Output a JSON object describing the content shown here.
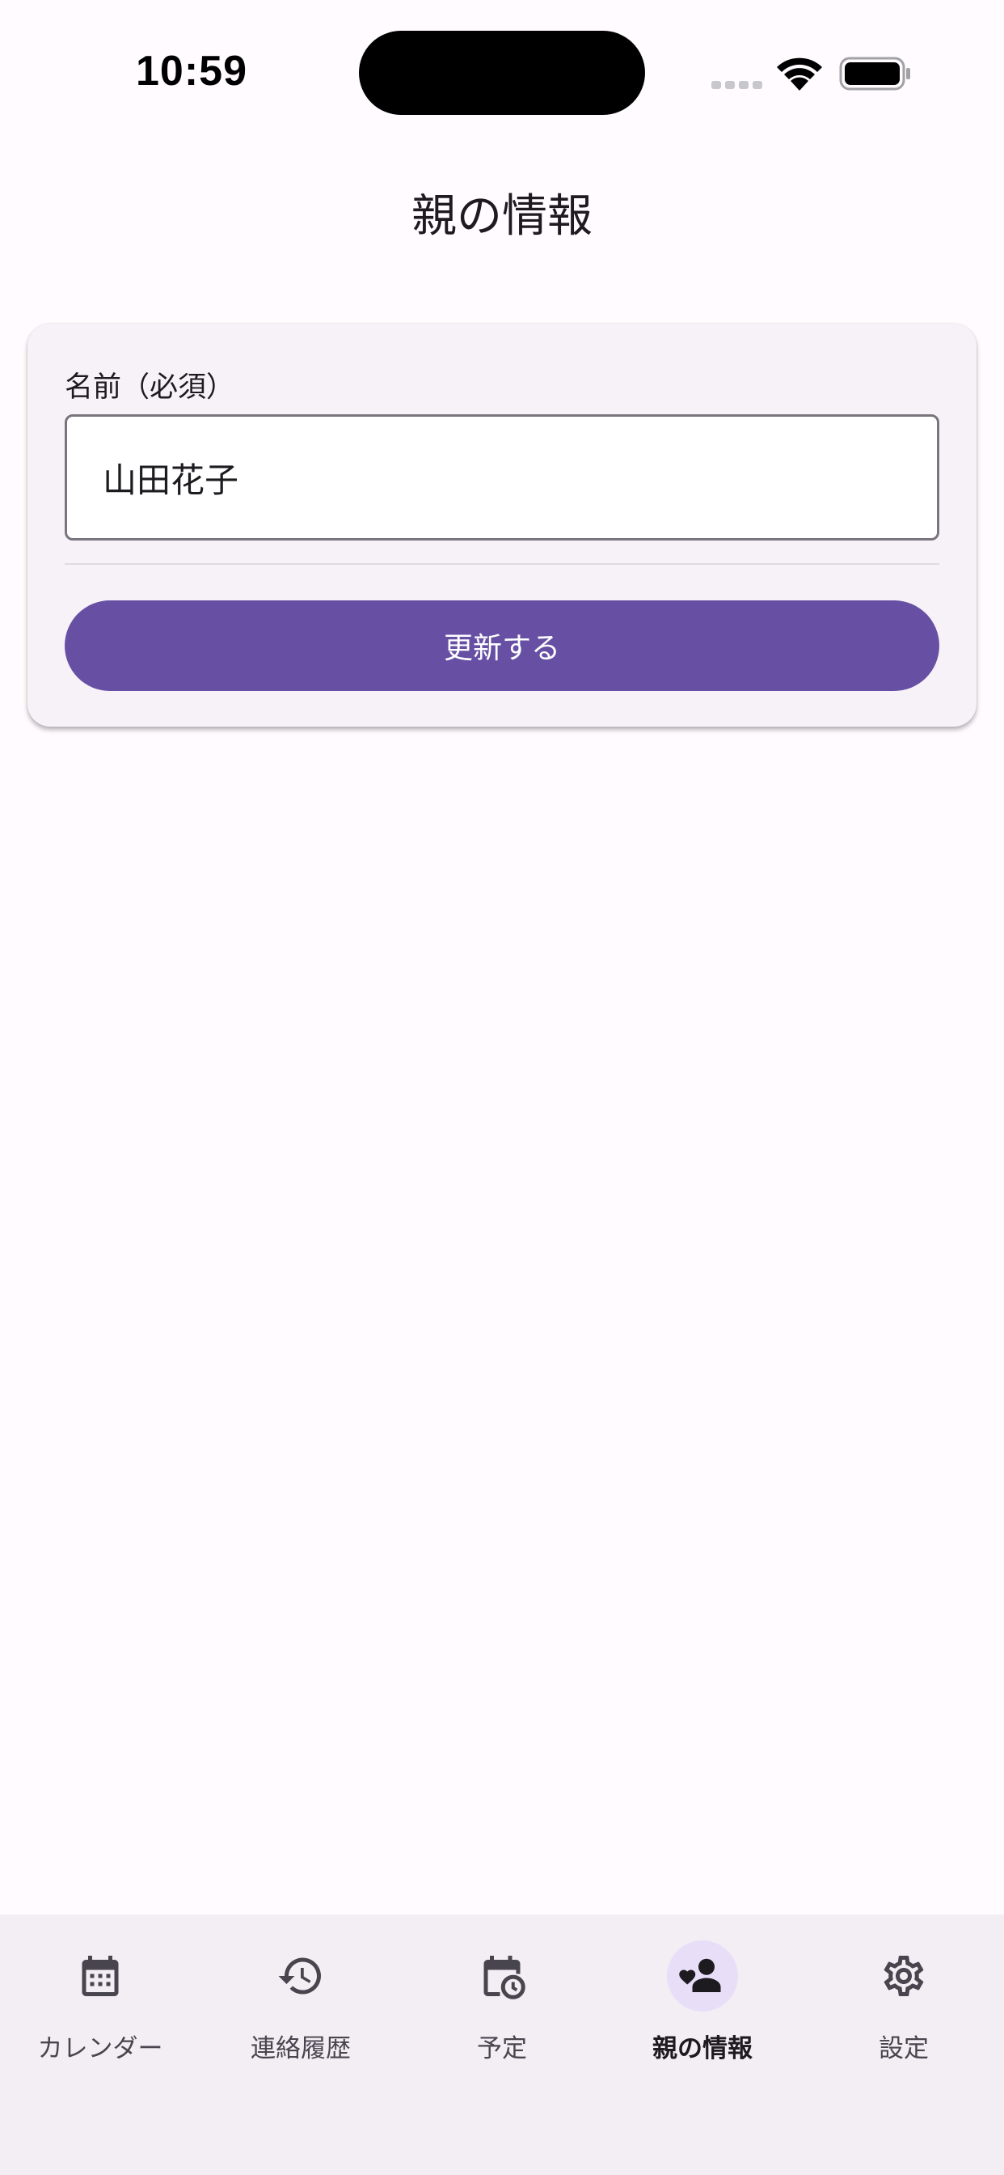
{
  "status_bar": {
    "time": "10:59"
  },
  "header": {
    "title": "親の情報"
  },
  "form": {
    "name_label": "名前（必須）",
    "name_value": "山田花子",
    "submit_label": "更新する"
  },
  "bottom_nav": {
    "items": [
      {
        "label": "カレンダー",
        "icon": "calendar-icon",
        "active": false
      },
      {
        "label": "連絡履歴",
        "icon": "history-icon",
        "active": false
      },
      {
        "label": "予定",
        "icon": "calendar-clock-icon",
        "active": false
      },
      {
        "label": "親の情報",
        "icon": "parent-heart-icon",
        "active": true
      },
      {
        "label": "設定",
        "icon": "gear-icon",
        "active": false
      }
    ]
  },
  "colors": {
    "primary": "#6750a4",
    "background": "#fffbfe",
    "card": "#f7f2f8",
    "nav_background": "#f3eef4",
    "active_indicator": "#e8def8"
  }
}
